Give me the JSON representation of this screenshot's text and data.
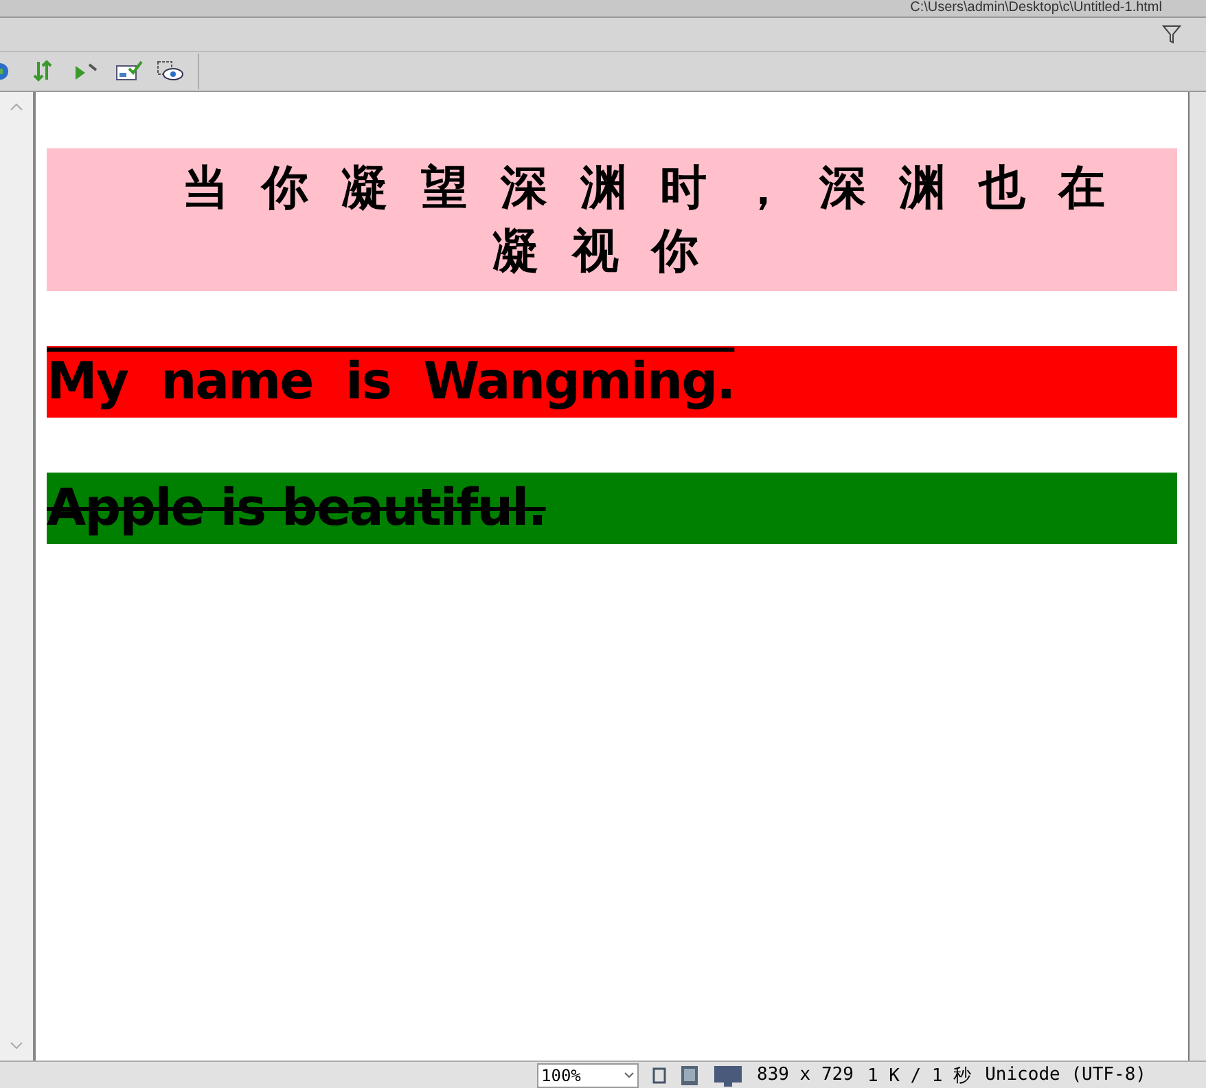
{
  "window": {
    "title": "C:\\Users\\admin\\Desktop\\c\\Untitled-1.html"
  },
  "toolbar": {
    "buttons": [
      {
        "kind": "globe"
      },
      {
        "kind": "arrows"
      },
      {
        "kind": "play"
      },
      {
        "kind": "check"
      },
      {
        "kind": "eye"
      }
    ]
  },
  "document": {
    "blocks": [
      {
        "text": "当你凝望深渊时，深渊也在凝视你",
        "color": "#ffc0cb",
        "overline": false,
        "strikethrough": false,
        "kind": "cjk"
      },
      {
        "text": "My name is Wangming.",
        "color": "#ff0000",
        "overline": true,
        "strikethrough": false,
        "kind": "wide"
      },
      {
        "text": "Apple is beautiful.",
        "color": "#008000",
        "overline": false,
        "strikethrough": true,
        "kind": "plain"
      }
    ]
  },
  "status_bar": {
    "zoom": "100%",
    "size": "839 x 729",
    "download": "1 K / 1 秒",
    "encoding": "Unicode (UTF-8)"
  }
}
